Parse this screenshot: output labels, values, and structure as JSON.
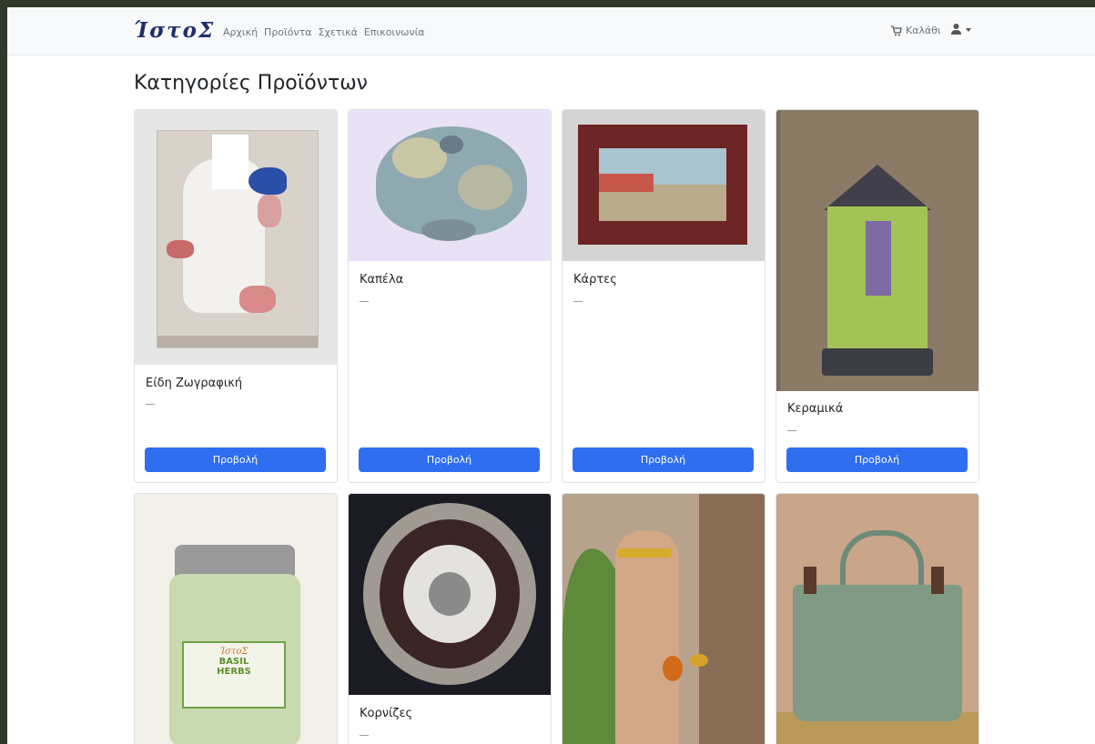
{
  "nav": {
    "brand": "ΊστοΣ",
    "links": [
      "Αρχική",
      "Προϊόντα",
      "Σχετικά",
      "Επικοινωνία"
    ],
    "cart_label": "Καλάθι",
    "cart_icon": "cart-icon",
    "user_icon": "user-icon"
  },
  "page": {
    "title": "Κατηγορίες Προϊόντων"
  },
  "categories": [
    {
      "title": "Είδη Ζωγραφική",
      "dash": "—",
      "button": "Προβολή"
    },
    {
      "title": "Καπέλα",
      "dash": "—",
      "button": "Προβολή"
    },
    {
      "title": "Κάρτες",
      "dash": "—",
      "button": "Προβολή"
    },
    {
      "title": "Κεραμικά",
      "dash": "—",
      "button": "Προβολή"
    },
    {
      "title": "",
      "dash": "",
      "button": ""
    },
    {
      "title": "Κορνίζες",
      "dash": "—",
      "button": ""
    },
    {
      "title": "",
      "dash": "",
      "button": ""
    },
    {
      "title": "",
      "dash": "",
      "button": ""
    }
  ],
  "jar_label": {
    "brand": "ΊστοΣ",
    "line1": "BASIL",
    "line2": "HERBS"
  },
  "colors": {
    "primary": "#2f6ef0",
    "brand": "#1f2f6b",
    "nav_bg": "#f8f9fa"
  }
}
